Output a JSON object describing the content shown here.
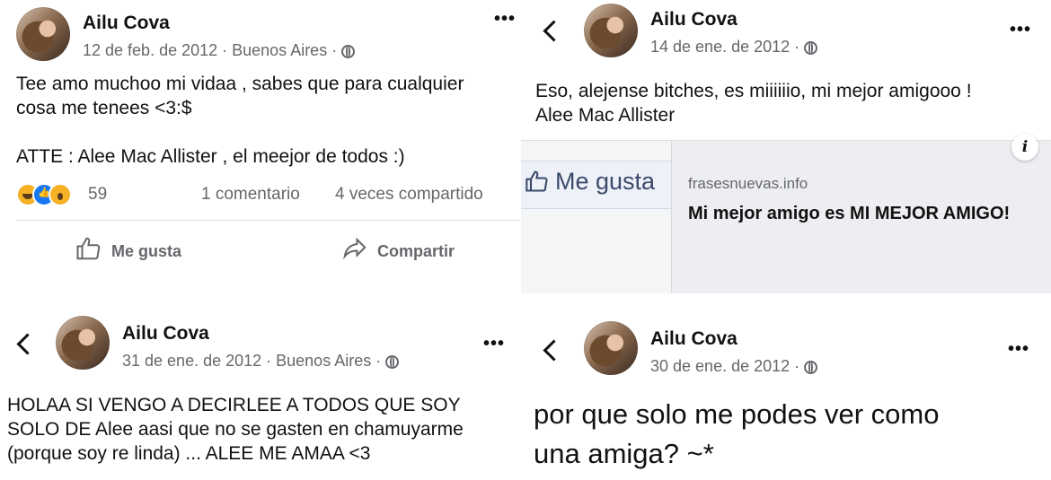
{
  "post1": {
    "author": "Ailu Cova",
    "meta": "12 de feb. de 2012 · Buenos Aires ·",
    "lines": [
      "Tee amo muchoo mi vidaa , sabes que para cualquier",
      "cosa me tenees <3:$",
      "",
      "ATTE : Alee Mac Allister , el meejor de todos :)"
    ],
    "reaction_count": "59",
    "comments": "1 comentario",
    "shares": "4 veces compartido",
    "like_label": "Me gusta",
    "share_label": "Compartir",
    "more_icon": "•••"
  },
  "post2": {
    "author": "Ailu Cova",
    "meta": "14 de ene. de 2012 ·",
    "lines": [
      "Eso, alejense bitches, es miiiiiio, mi mejor amigooo !",
      "Alee Mac Allister"
    ],
    "more_icon": "•••",
    "preview": {
      "thumb_text": "Me gusta",
      "domain": "frasesnuevas.info",
      "title": "Mi mejor amigo es MI MEJOR AMIGO!",
      "info_icon": "i"
    }
  },
  "post3": {
    "author": "Ailu Cova",
    "meta": "31 de ene. de 2012 · Buenos Aires ·",
    "lines": [
      "HOLAA SI VENGO A DECIRLEE A TODOS QUE SOY",
      "SOLO DE Alee aasi que no se gasten en chamuyarme",
      "(porque soy re linda) ... ALEE ME AMAA <3"
    ],
    "more_icon": "•••"
  },
  "post4": {
    "author": "Ailu Cova",
    "meta": "30 de ene. de 2012 ·",
    "lines": [
      "por que solo me podes ver como",
      "una amiga? ~*"
    ],
    "more_icon": "•••"
  },
  "icons": {
    "back": "chevron-left-icon",
    "globe": "globe-icon",
    "more": "more-options-icon",
    "like": "thumbs-up-icon",
    "share": "share-arrow-icon"
  }
}
